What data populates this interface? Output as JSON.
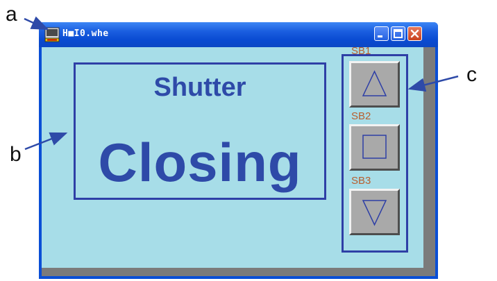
{
  "annotations": {
    "a": "a",
    "b": "b",
    "c": "c"
  },
  "window": {
    "title": "H■I0.whe",
    "app_icon": "hmi-app-icon",
    "controls": [
      "minimize-icon",
      "maximize-icon",
      "close-icon"
    ]
  },
  "display": {
    "line1": "Shutter",
    "line2": "Closing"
  },
  "buttons": [
    {
      "label": "SB1",
      "icon": "triangle-up-icon"
    },
    {
      "label": "SB2",
      "icon": "square-stop-icon"
    },
    {
      "label": "SB3",
      "icon": "triangle-down-icon"
    }
  ],
  "colors": {
    "titlebar": "#1b5fe0",
    "client": "#a7dde8",
    "text_blue": "#2e4aa8",
    "border_blue": "#2e3fa6",
    "button_gray": "#a9a9a9",
    "label_orange": "#b85e2e"
  }
}
